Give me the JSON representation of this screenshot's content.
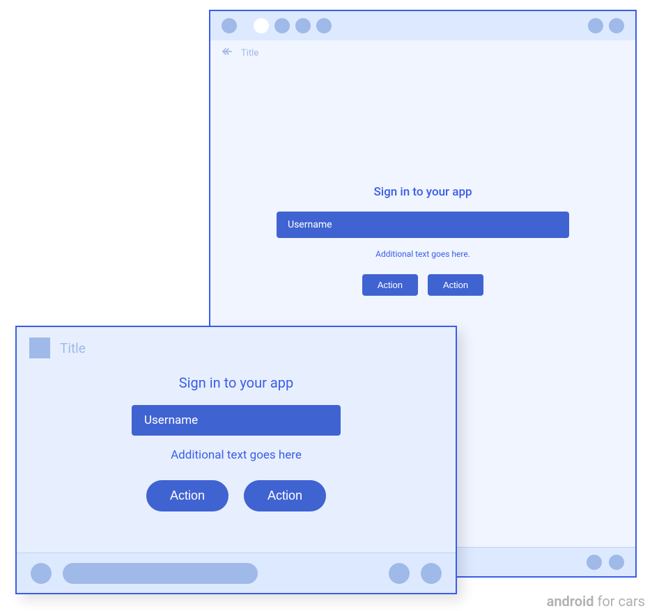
{
  "tablet": {
    "title": "Title",
    "heading": "Sign in to your app",
    "input_placeholder": "Username",
    "additional": "Additional text goes here.",
    "action1": "Action",
    "action2": "Action"
  },
  "phone": {
    "title": "Title",
    "heading": "Sign in to your app",
    "input_placeholder": "Username",
    "additional": "Additional text goes here",
    "action1": "Action",
    "action2": "Action"
  },
  "watermark": {
    "brand": "android",
    "suffix": " for cars"
  }
}
